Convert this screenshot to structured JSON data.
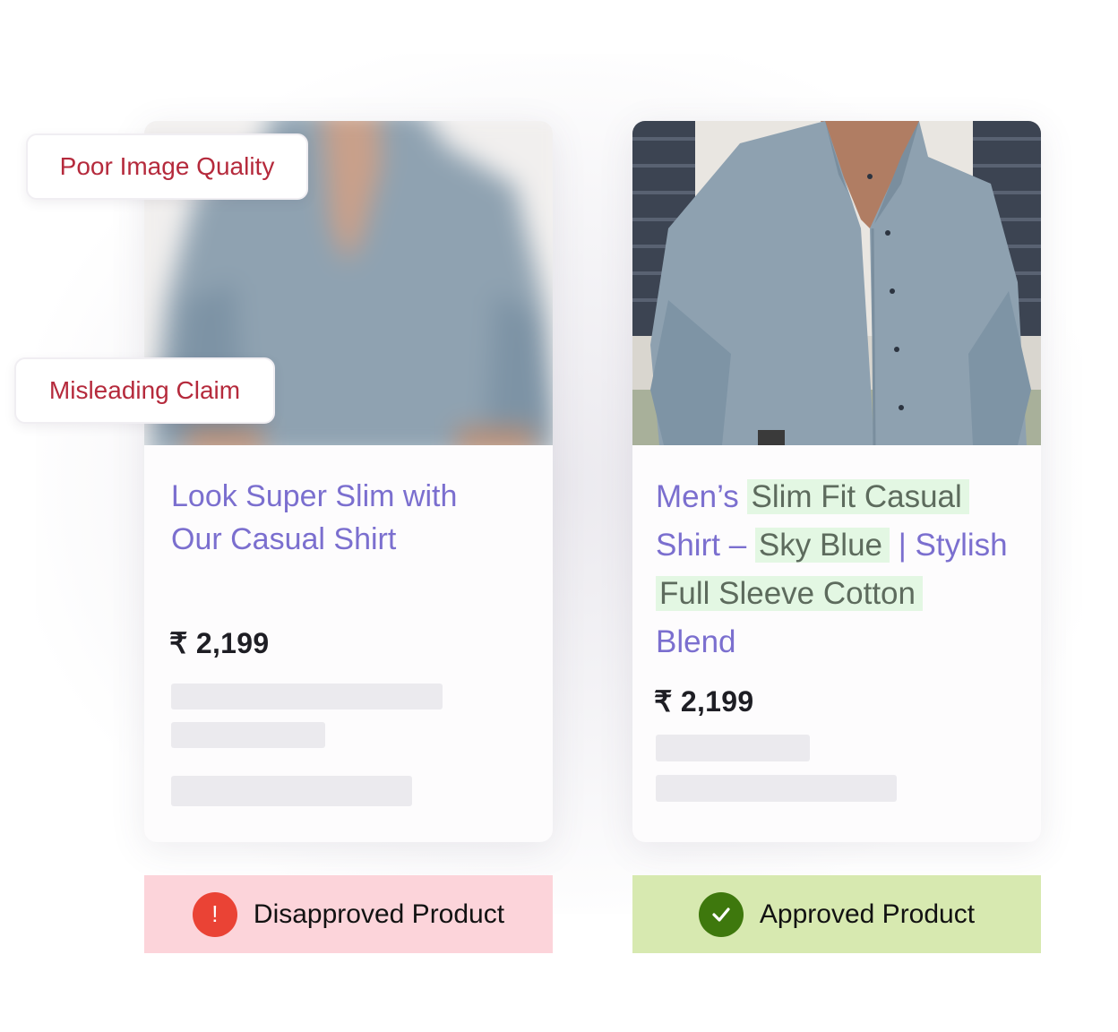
{
  "left_card": {
    "title_line1": "Look Super Slim with",
    "title_line2": "Our Casual Shirt",
    "price": "₹ 2,199",
    "tags": [
      "Poor Image Quality",
      "Misleading Claim"
    ],
    "status": {
      "label": "Disapproved Product",
      "icon": "alert-icon",
      "icon_glyph": "!",
      "color": "#fcd4da"
    }
  },
  "right_card": {
    "title_parts": [
      "Men’s ",
      "Slim Fit Casual",
      "Shirt – ",
      "Sky Blue",
      " | Stylish",
      "Full Sleeve Cotton",
      "Blend"
    ],
    "price": "₹ 2,199",
    "status": {
      "label": "Approved Product",
      "icon": "check-icon",
      "color": "#d7e9b0"
    }
  },
  "colors": {
    "title_purple": "#7b6fcf",
    "highlight_green": "#e3f7e3",
    "tag_red": "#b52a3c",
    "alert_red": "#ea4335",
    "check_green": "#3e780d"
  }
}
